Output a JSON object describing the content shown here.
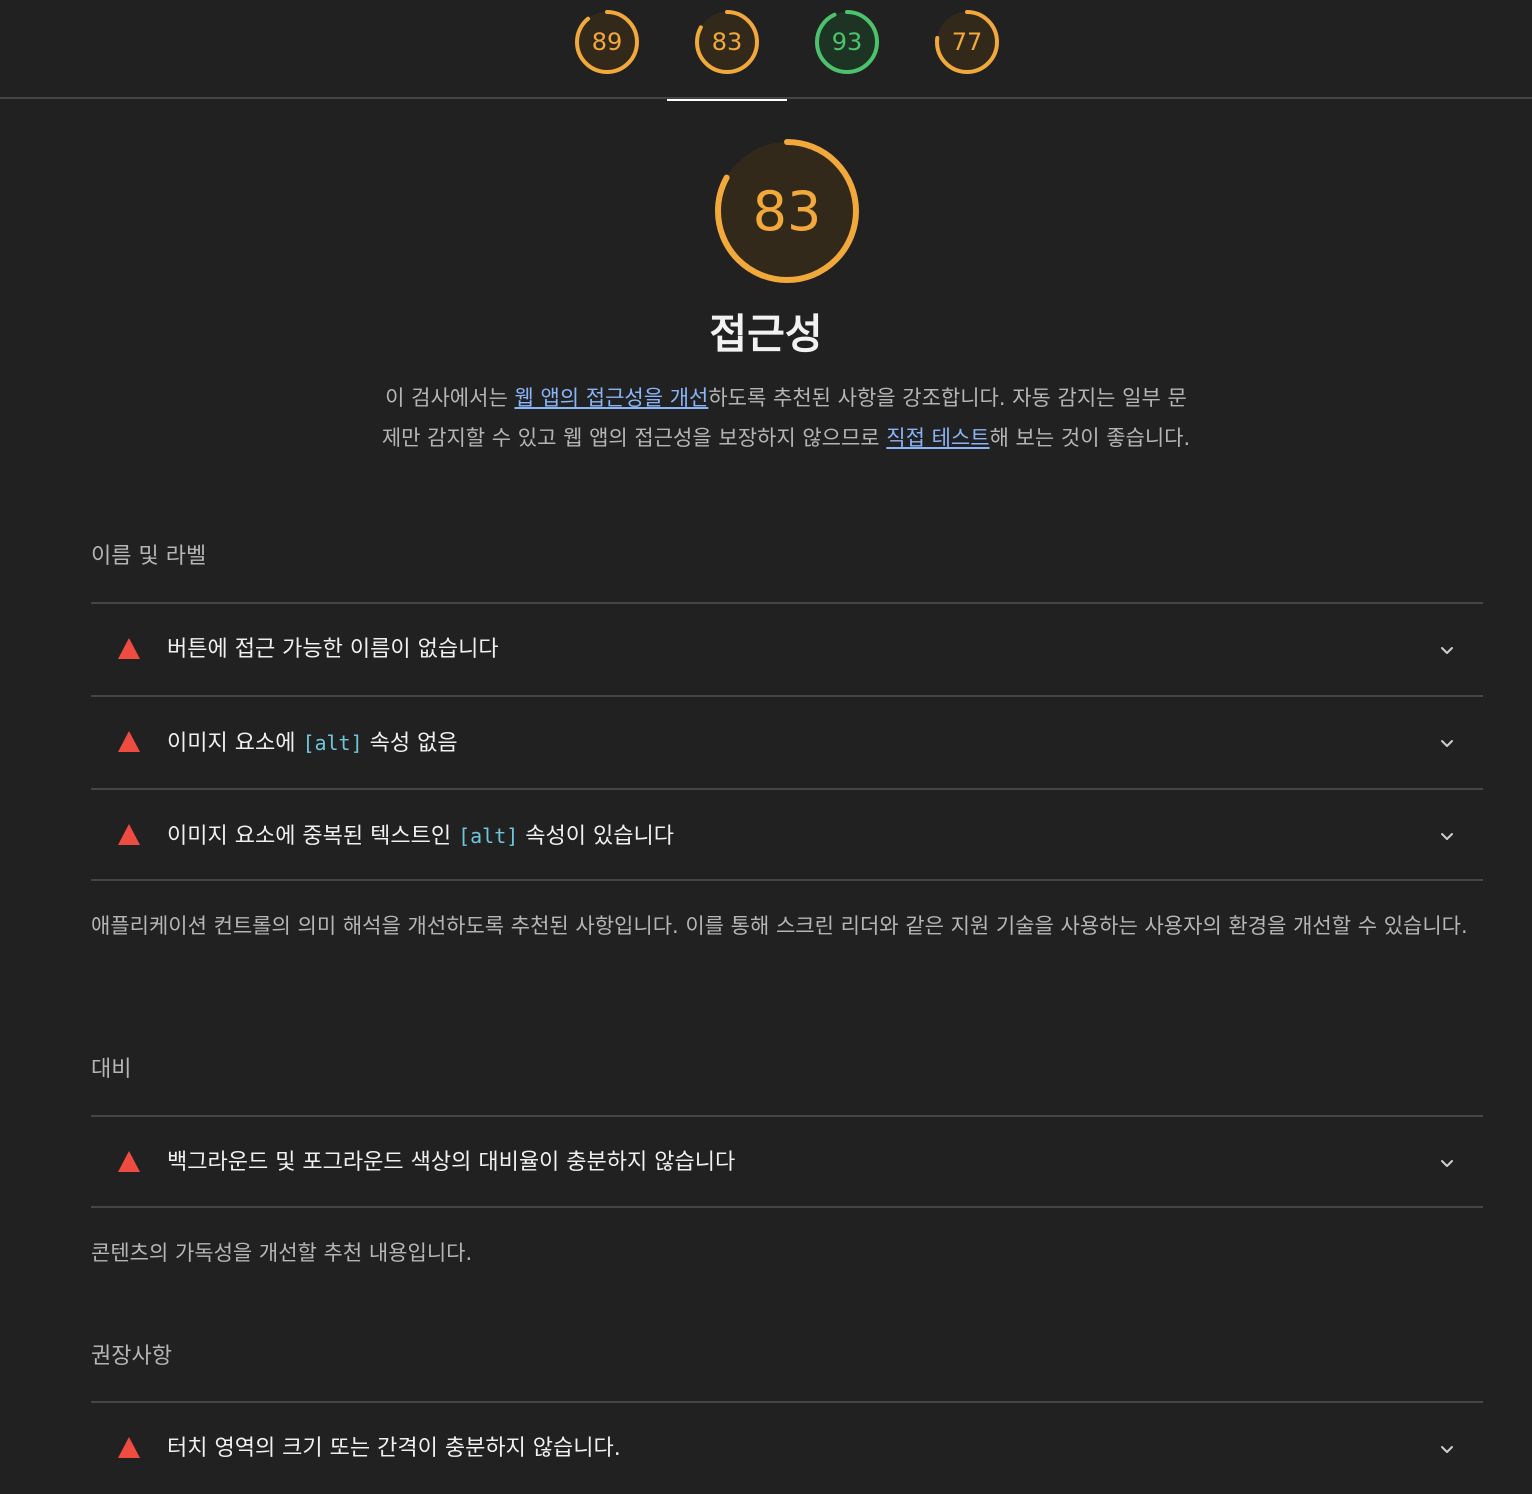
{
  "colors": {
    "background": "#212121",
    "average": "#f2a93b",
    "pass": "#4bc26b",
    "fail": "#ee4c41",
    "link": "#8ab4f8",
    "code": "#6fc6da"
  },
  "tabs": [
    {
      "score": "89",
      "status": "average",
      "selected": false
    },
    {
      "score": "83",
      "status": "average",
      "selected": true
    },
    {
      "score": "93",
      "status": "pass",
      "selected": false
    },
    {
      "score": "77",
      "status": "average",
      "selected": false
    }
  ],
  "category": {
    "score": "83",
    "score_value": 83,
    "title": "접근성",
    "desc_part1": "이 검사에서는 ",
    "desc_link1": "웹 앱의 접근성을 개선",
    "desc_part2": "하도록 추천된 사항을 강조합니다. 자동 감지는 일부 문제만 감지할 수 있고 웹 앱의 접근성을 보장하지 않으므로 ",
    "desc_link2": "직접 테스트",
    "desc_part3": "해 보는 것이 좋습니다."
  },
  "groups": [
    {
      "title": "이름 및 라벨",
      "audits": [
        {
          "before": "버튼에 접근 가능한 이름이 없습니다",
          "code": "",
          "after": ""
        },
        {
          "before": "이미지 요소에 ",
          "code": "[alt]",
          "after": " 속성 없음"
        },
        {
          "before": "이미지 요소에 중복된 텍스트인 ",
          "code": "[alt]",
          "after": " 속성이 있습니다"
        }
      ],
      "description": "애플리케이션 컨트롤의 의미 해석을 개선하도록 추천된 사항입니다. 이를 통해 스크린 리더와 같은 지원 기술을 사용하는 사용자의 환경을 개선할 수 있습니다."
    },
    {
      "title": "대비",
      "audits": [
        {
          "before": "백그라운드 및 포그라운드 색상의 대비율이 충분하지 않습니다",
          "code": "",
          "after": ""
        }
      ],
      "description": "콘텐츠의 가독성을 개선할 추천 내용입니다."
    },
    {
      "title": "권장사항",
      "audits": [
        {
          "before": "터치 영역의 크기 또는 간격이 충분하지 않습니다.",
          "code": "",
          "after": ""
        }
      ]
    }
  ]
}
